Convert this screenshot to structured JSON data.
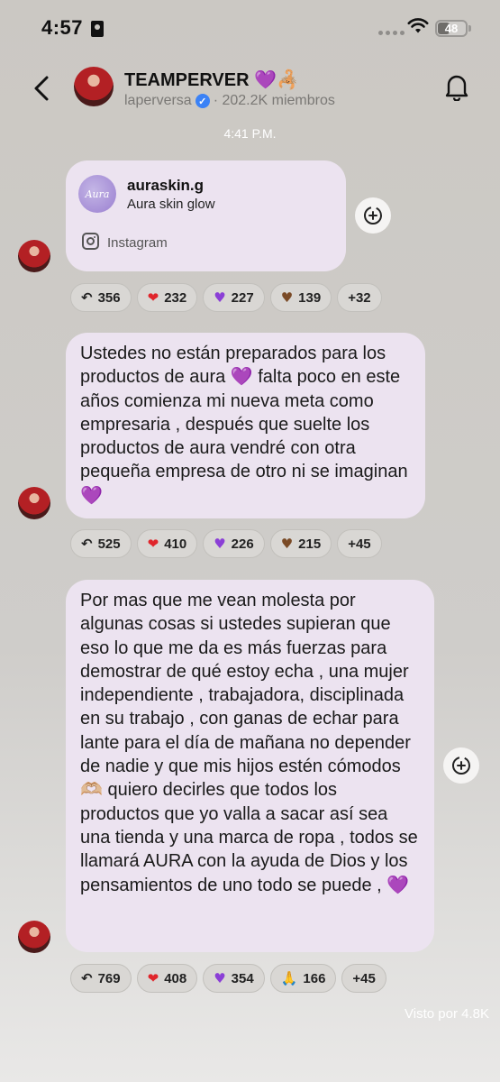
{
  "status_bar": {
    "time": "4:57",
    "battery": "48"
  },
  "header": {
    "title": "TEAMPERVER 💜🦂",
    "subtitle_user": "laperversa",
    "subtitle_members": "· 202.2K miembros"
  },
  "timestamp": "4:41 P.M.",
  "messages": [
    {
      "type": "link_card",
      "name": "auraskin.g",
      "description": "Aura skin glow",
      "source": "Instagram",
      "logo_text": "Aura",
      "reactions": [
        {
          "icon": "reply-icon",
          "count": "356"
        },
        {
          "emoji": "❤",
          "count": "232"
        },
        {
          "emoji": "♥",
          "count": "227"
        },
        {
          "emoji": "♥",
          "count": "139"
        },
        {
          "label": "+32"
        }
      ]
    },
    {
      "type": "text",
      "text": "Ustedes no están preparados para los productos de aura 💜 falta poco en este años comienza mi nueva meta como empresaria , después que suelte los productos de aura vendré con otra pequeña empresa de otro ni se imaginan 💜",
      "reactions": [
        {
          "icon": "reply-icon",
          "count": "525"
        },
        {
          "emoji": "❤",
          "count": "410"
        },
        {
          "emoji": "♥",
          "count": "226"
        },
        {
          "emoji": "♥",
          "count": "215"
        },
        {
          "label": "+45"
        }
      ]
    },
    {
      "type": "text",
      "text": "Por mas que me vean molesta por algunas cosas si ustedes supieran que eso lo que me da es más fuerzas para demostrar de qué estoy echa , una mujer independiente , trabajadora, disciplinada en su trabajo , con ganas de echar para lante para el día de mañana no depender de nadie y que mis hijos estén cómodos 🫶🏼 quiero decirles que todos los productos que yo valla a sacar así sea una tienda y una marca de ropa , todos se llamará AURA con la ayuda de Dios y los pensamientos de uno todo se puede , 💜",
      "reactions": [
        {
          "icon": "reply-icon",
          "count": "769"
        },
        {
          "emoji": "❤",
          "count": "408"
        },
        {
          "emoji": "♥",
          "count": "354"
        },
        {
          "emoji": "🙏",
          "count": "166"
        },
        {
          "label": "+45"
        }
      ]
    }
  ],
  "seen_by": "Visto por 4.8K"
}
